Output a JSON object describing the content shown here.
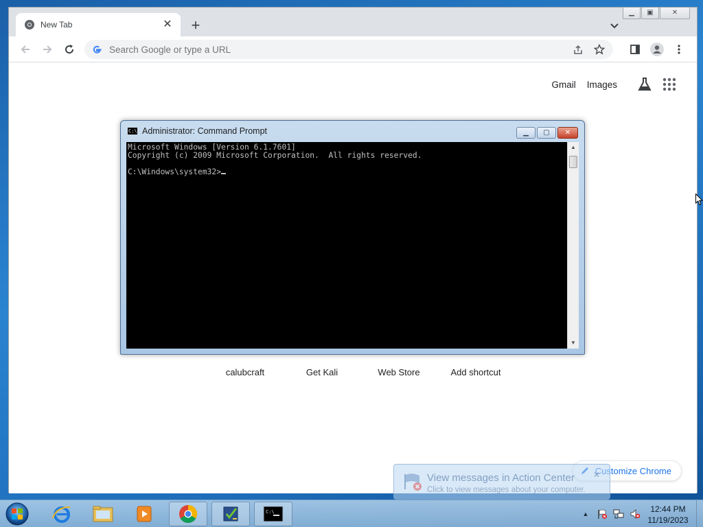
{
  "browser": {
    "tab": {
      "title": "New Tab"
    },
    "omnibox": {
      "placeholder": "Search Google or type a URL"
    },
    "top_links": [
      "Gmail",
      "Images"
    ],
    "shortcuts": [
      "calubcraft",
      "Get Kali",
      "Web Store",
      "Add shortcut"
    ],
    "customize_label": "Customize Chrome",
    "accent_color": "#1a73e8"
  },
  "cmd": {
    "title": "Administrator:  Command Prompt",
    "lines": [
      "Microsoft Windows [Version 6.1.7601]",
      "Copyright (c) 2009 Microsoft Corporation.  All rights reserved.",
      "",
      "C:\\Windows\\system32>"
    ]
  },
  "balloon": {
    "title": "View messages in Action Center",
    "text": "Click to view messages about your computer."
  },
  "taskbar": {
    "apps": [
      "internet-explorer",
      "windows-explorer",
      "media-player",
      "chrome",
      "checklist-app",
      "command-prompt"
    ],
    "clock_time": "12:44 PM",
    "clock_date": "11/19/2023"
  }
}
